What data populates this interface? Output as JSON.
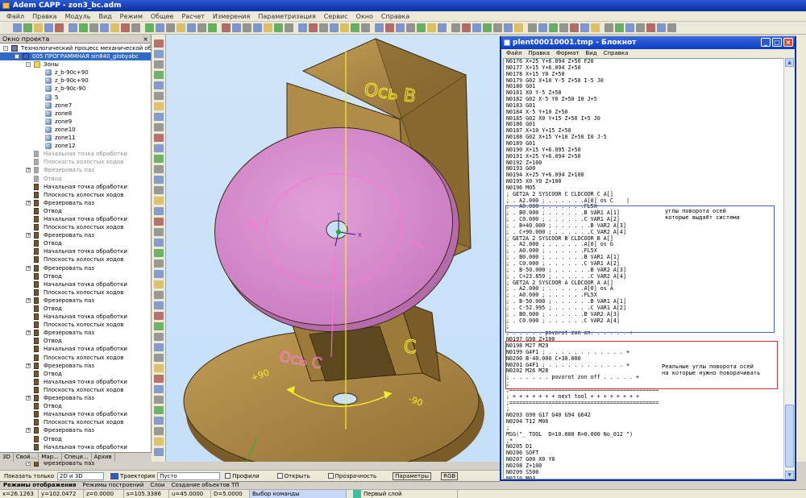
{
  "app": {
    "title": "Adem CAPP - zon3_bc.adm"
  },
  "menu": [
    "Файл",
    "Правка",
    "Модуль",
    "Вид",
    "Режим",
    "Общее",
    "Расчет",
    "Измерения",
    "Параметризация",
    "Сервис",
    "Окно",
    "Справка"
  ],
  "project_pane": {
    "title": "Окно проекта",
    "close": "×",
    "tree": [
      {
        "label": "Технологический процесс механической обработ",
        "icon": "book",
        "indent": 0,
        "expander": "-"
      },
      {
        "label": "005 ПРОГРАММНАЯ sin840_globyabc",
        "icon": "prog",
        "indent": 1,
        "expander": "-",
        "selected": true
      },
      {
        "label": "Зоны",
        "icon": "folder",
        "indent": 2,
        "expander": "-"
      },
      {
        "label": "z_b-90c+90",
        "icon": "zone",
        "indent": 3
      },
      {
        "label": "z_b-90c+90",
        "icon": "zone",
        "indent": 3
      },
      {
        "label": "z_b-90c-90",
        "icon": "zone",
        "indent": 3
      },
      {
        "label": "5",
        "icon": "zone",
        "indent": 3
      },
      {
        "label": "zone7",
        "icon": "zone",
        "indent": 3
      },
      {
        "label": "zone8",
        "icon": "zone",
        "indent": 3
      },
      {
        "label": "zone9",
        "icon": "zone",
        "indent": 3
      },
      {
        "label": "zone10",
        "icon": "zone",
        "indent": 3
      },
      {
        "label": "zone11",
        "icon": "zone",
        "indent": 3
      },
      {
        "label": "zone12",
        "icon": "zone",
        "indent": 3
      },
      {
        "label": "Начальная точка обработки",
        "icon": "opg",
        "indent": 2,
        "gray": true
      },
      {
        "label": "Плоскость холостых ходов",
        "icon": "opg",
        "indent": 2,
        "gray": true
      },
      {
        "label": "Фрезеровать паз",
        "icon": "opg",
        "indent": 2,
        "gray": true,
        "expander": "+"
      },
      {
        "label": "Отвод",
        "icon": "opg",
        "indent": 2,
        "gray": true
      },
      {
        "label": "Начальная точка обработки",
        "icon": "op",
        "indent": 2
      },
      {
        "label": "Плоскость холостых ходов",
        "icon": "op",
        "indent": 2
      },
      {
        "label": "Фрезеровать паз",
        "icon": "op",
        "indent": 2,
        "expander": "+"
      },
      {
        "label": "Отвод",
        "icon": "op",
        "indent": 2
      },
      {
        "label": "Начальная точка обработки",
        "icon": "op",
        "indent": 2
      },
      {
        "label": "Плоскость холостых ходов",
        "icon": "op",
        "indent": 2
      },
      {
        "label": "Фрезеровать паз",
        "icon": "op",
        "indent": 2,
        "expander": "+"
      },
      {
        "label": "Отвод",
        "icon": "op",
        "indent": 2
      },
      {
        "label": "Начальная точка обработки",
        "icon": "op",
        "indent": 2
      },
      {
        "label": "Плоскость холостых ходов",
        "icon": "op",
        "indent": 2
      },
      {
        "label": "Фрезеровать паз",
        "icon": "op",
        "indent": 2,
        "expander": "+"
      },
      {
        "label": "Отвод",
        "icon": "op",
        "indent": 2
      },
      {
        "label": "Начальная точка обработки",
        "icon": "op",
        "indent": 2
      },
      {
        "label": "Плоскость холостых ходов",
        "icon": "op",
        "indent": 2
      },
      {
        "label": "Фрезеровать паз",
        "icon": "op",
        "indent": 2,
        "expander": "+"
      },
      {
        "label": "Отвод",
        "icon": "op",
        "indent": 2
      },
      {
        "label": "Начальная точка обработки",
        "icon": "op",
        "indent": 2
      },
      {
        "label": "Плоскость холостых ходов",
        "icon": "op",
        "indent": 2
      },
      {
        "label": "Фрезеровать паз",
        "icon": "op",
        "indent": 2,
        "expander": "+"
      },
      {
        "label": "Отвод",
        "icon": "op",
        "indent": 2
      },
      {
        "label": "Начальная точка обработки",
        "icon": "op",
        "indent": 2
      },
      {
        "label": "Плоскость холостых ходов",
        "icon": "op",
        "indent": 2
      },
      {
        "label": "Фрезеровать паз",
        "icon": "op",
        "indent": 2,
        "expander": "+"
      },
      {
        "label": "Отвод",
        "icon": "op",
        "indent": 2
      },
      {
        "label": "Начальная точка обработки",
        "icon": "op",
        "indent": 2
      },
      {
        "label": "Плоскость холостых ходов",
        "icon": "op",
        "indent": 2
      },
      {
        "label": "Фрезеровать паз",
        "icon": "op",
        "indent": 2,
        "expander": "+"
      },
      {
        "label": "Отвод",
        "icon": "op",
        "indent": 2
      },
      {
        "label": "Начальная точка обработки",
        "icon": "op",
        "indent": 2
      },
      {
        "label": "Плоскость холостых ходов",
        "icon": "op",
        "indent": 2
      },
      {
        "label": "Фрезеровать паз",
        "icon": "op",
        "indent": 2,
        "expander": "+"
      },
      {
        "label": "Отвод",
        "icon": "op",
        "indent": 2
      },
      {
        "label": "Начальная точка обработки",
        "icon": "op",
        "indent": 2
      },
      {
        "label": "Плоскость холостых ходов",
        "icon": "op",
        "indent": 2
      },
      {
        "label": "Фрезеровать паз",
        "icon": "op",
        "indent": 2,
        "expander": "+"
      }
    ]
  },
  "left_tabs": [
    "3D",
    "Свой...",
    "Мар...",
    "Специ...",
    "Архив"
  ],
  "bottom_bar": {
    "show_only_label": "Показать только",
    "mode_value": "2D и 3D",
    "trajectory_label": "Траектория",
    "trajectory_value": "Пусто",
    "profiles": "Профили",
    "open": "Открыть",
    "transparency": "Прозрачность",
    "params_button": "Параметры",
    "rgb_button": "RGB"
  },
  "bottom_tabs": [
    "Режимы отображения",
    "Режимы построений",
    "Слои",
    "Создание объектов ТП"
  ],
  "status": {
    "x": "x=26.1263",
    "y": "y=102.0472",
    "z": "z=0.0000",
    "s": "s=105.3386",
    "u": "u=45.0000",
    "d": "D=5.0000",
    "command": "Выбор команды",
    "layer": "Первый слой"
  },
  "viewport": {
    "label_b_top": "Ось B",
    "label_c": "C",
    "label_plus90": "+90",
    "label_minus90": "-90",
    "label_plus": "+",
    "label_minus": "-",
    "label_axis_y": "Y",
    "label_axis_x": "X",
    "label_bottom": "Ось C"
  },
  "notepad": {
    "title": "plent00010001.tmp - Блокнот",
    "btn_min": "_",
    "btn_max": "□",
    "btn_close": "×",
    "menu": [
      "Файл",
      "Правка",
      "Формат",
      "Вид",
      "Справка"
    ],
    "code": "N0176 X+25 Y+6.094 Z+50 F20\nN0177 X+15 Y+6.094 Z+50\nN0178 X+15 Y0 Z+50\nN0179 G02 X+10 Y-5 Z+50 I-5 J0\nN0180 G01\nN0181 X0 Y-5 Z+50\nN0182 G02 X-5 Y0 Z+50 I0 J+5\nN0183 G01\nN0184 X-5 Y+10 Z+50\nN0185 G02 X0 Y+15 Z+50 I+5 J0\nN0186 G01\nN0187 X+10 Y+15 Z+50\nN0188 G02 X+15 Y+10 Z+50 I0 J-5\nN0189 G01\nN0190 X+15 Y+6.095 Z+50\nN0191 X+25 Y+6.094 Z+50\nN0192 Z+100\nN0193 G00\nN0194 X+25 Y+6.094 Z+100\nN0195 X0 Y0 Z+100\nN0196 M05\n; GET2A 2 SYSCOOR C CLDCOOR C A[]\n; . A2.000 ; . . . . . .A[0] os C    |\n; . A0.000 ; . . . . . .FL5X\n; . B0.000 ; . . . . . .B VAR1 A[1]\n; . C0.000 ; . . . . . .C VAR1 A[2]\n; . B+40.000 ; . . . . . .B VAR2 A[3]\n; . C+90.000 ; . . . . . .C VAR2 A[4]\n; GET2A 2 SYSCOOR B CLDCOOR B A[]\n; . A2.000 ; . . . . . .A[0] os b\n; . A0.000 ; . . . . . .FL5X\n; . B0.000 ; . . . . . .B VAR1 A[1]\n; . C0.000 ; . . . . . .C VAR1 A[2]\n; . B-50.000 ; . . . . . .B VAR2 A[3]\n; . C+23.859 ; . . . . . .C VAR2 A[4]\n; GET2A 2 SYSCOOR A CLDCOOR A A[]\n; . A2.000 ; . . . . . .A[0] os A\n; . A0.000 ; . . . . . .FL5X\n; . B-50.000 ; . . . . . .B VAR1 A[1]\n; . C-52.995 ; . . . . . .C VAR1 A[2]\n; . B0.000 ; . . . . . .B VAR2 A[3]\n; . C0.000 ; . . . . . .C VAR2 A[4]\n;\n; . . . . . povorot zon on. . . . . . +\nN0197 G90 Z+100\nN0198 M27 M29\nN0199 G4F1 ; . . . . . . . . . . . . +\nN0200 B-40.000 C+30.000\nN0201 G4F1 ; . . . . . . . . . . . . +\nN0202 M26 M28\n; . . . . . . povorot zon off . . . . . +\n;\n;==============================================\n; + + + + + + + next tool + + + + + + + +\n;==============================================\n;\nN0203 G90 G17 G40 G94 G642\nN0204 T12 M06\n;\nMSG(\"_ TOOL  D=10.000 R=0.000 No_012 \")\n;*\nN0205 D1\nN0206 SOFT\nN0207 G00 X0 Y0\nN0208 Z+100\nN0209 S500\nN0210 M03\nN0211 X0 Y+10 Z+100\nN0212 X0 Y+10 Z+2",
    "note1": "углы поворота осей\nкоторые выдаёт система",
    "note2": "Реальные углы поворота осей\nна которые нужно поворачивать"
  },
  "colors": {
    "title_blue": "#0a2f9e",
    "viewport_bg": "#c8e1f8",
    "part_brown": "#a88442",
    "disc_pink": "#d98ad0",
    "axis_yellow": "#f2ee2a",
    "pink_trace": "#ff80e0"
  }
}
